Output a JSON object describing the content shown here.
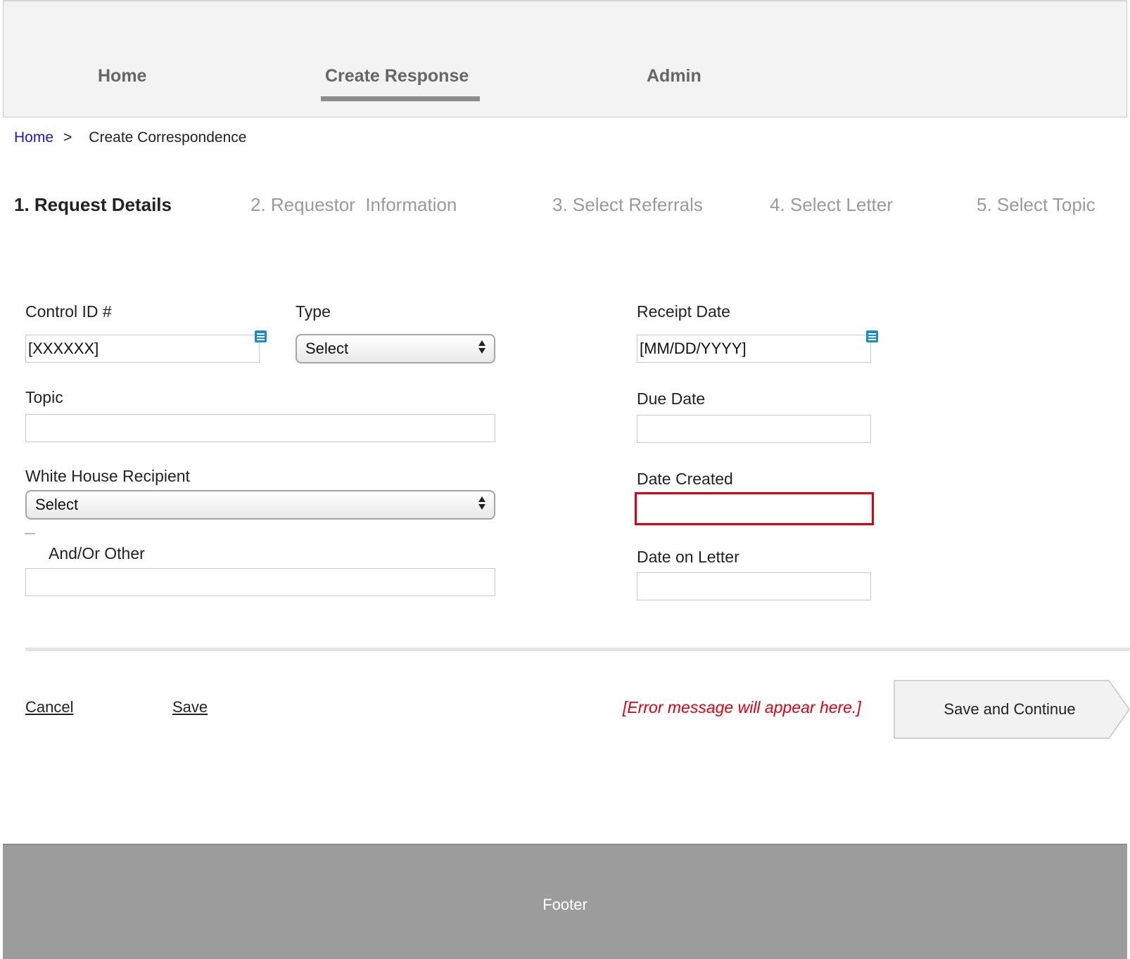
{
  "nav": {
    "items": [
      {
        "label": "Home"
      },
      {
        "label": "Create Response"
      },
      {
        "label": "Admin"
      }
    ]
  },
  "breadcrumb": {
    "home": "Home",
    "separator": ">",
    "current": "Create Correspondence"
  },
  "steps": [
    {
      "label": "1. Request Details"
    },
    {
      "label": "2. Requestor  Information"
    },
    {
      "label": "3. Select Referrals"
    },
    {
      "label": "4. Select Letter"
    },
    {
      "label": "5. Select Topic"
    }
  ],
  "form": {
    "control_id": {
      "label": "Control ID #",
      "value": "[XXXXXX]"
    },
    "type": {
      "label": "Type",
      "selected": "Select"
    },
    "receipt_date": {
      "label": "Receipt Date",
      "value": "[MM/DD/YYYY]"
    },
    "topic": {
      "label": "Topic",
      "value": ""
    },
    "due_date": {
      "label": "Due Date",
      "value": ""
    },
    "white_house_recipient": {
      "label": "White House Recipient",
      "selected": "Select"
    },
    "date_created": {
      "label": "Date Created",
      "value": ""
    },
    "and_or_other": {
      "label": "And/Or Other",
      "value": ""
    },
    "date_on_letter": {
      "label": "Date on Letter",
      "value": ""
    }
  },
  "actions": {
    "cancel": "Cancel",
    "save": "Save",
    "error_message": "[Error message will appear here.]",
    "save_continue": "Save and Continue"
  },
  "footer": {
    "text": "Footer"
  },
  "colors": {
    "error": "#e00010",
    "link": "#1717d4",
    "note_icon": "#1d8ad0",
    "footer_bg": "#9c9c9c",
    "nav_bg": "#f3f3f3"
  },
  "icons": {
    "note": "note-icon",
    "select_arrows": "select-arrows-icon"
  }
}
